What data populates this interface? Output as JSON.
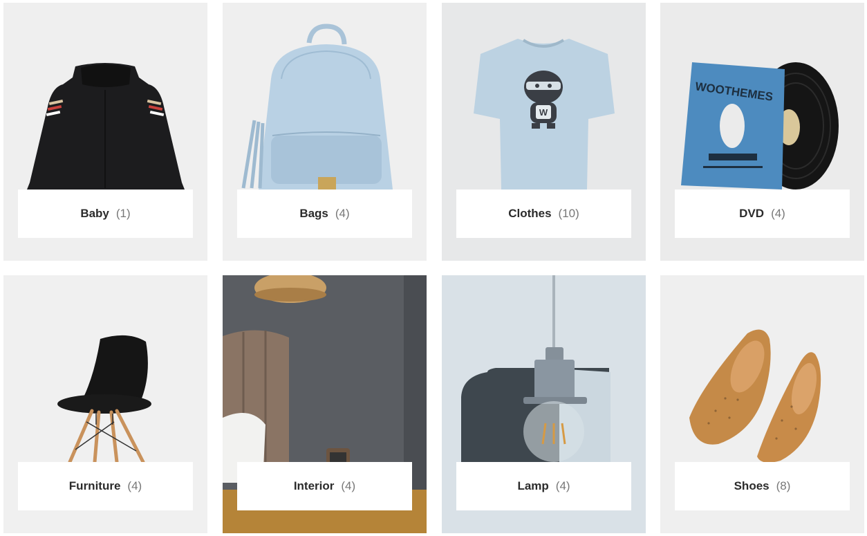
{
  "categories": [
    {
      "name": "Baby",
      "count": "(1)",
      "icon": "jacket-image"
    },
    {
      "name": "Bags",
      "count": "(4)",
      "icon": "backpack-image"
    },
    {
      "name": "Clothes",
      "count": "(10)",
      "icon": "tshirt-image"
    },
    {
      "name": "DVD",
      "count": "(4)",
      "icon": "vinyl-record-image"
    },
    {
      "name": "Furniture",
      "count": "(4)",
      "icon": "chair-image"
    },
    {
      "name": "Interior",
      "count": "(4)",
      "icon": "bedroom-image"
    },
    {
      "name": "Lamp",
      "count": "(4)",
      "icon": "pendant-lamp-image"
    },
    {
      "name": "Shoes",
      "count": "(8)",
      "icon": "flat-shoes-image"
    }
  ],
  "art_text": {
    "album_title": "WOOTHEMES",
    "shirt_letter": "W"
  },
  "colors": {
    "tile_background": "#efefef",
    "label_background": "#ffffff",
    "name_text": "#2b2b2b",
    "count_text": "#777777"
  }
}
